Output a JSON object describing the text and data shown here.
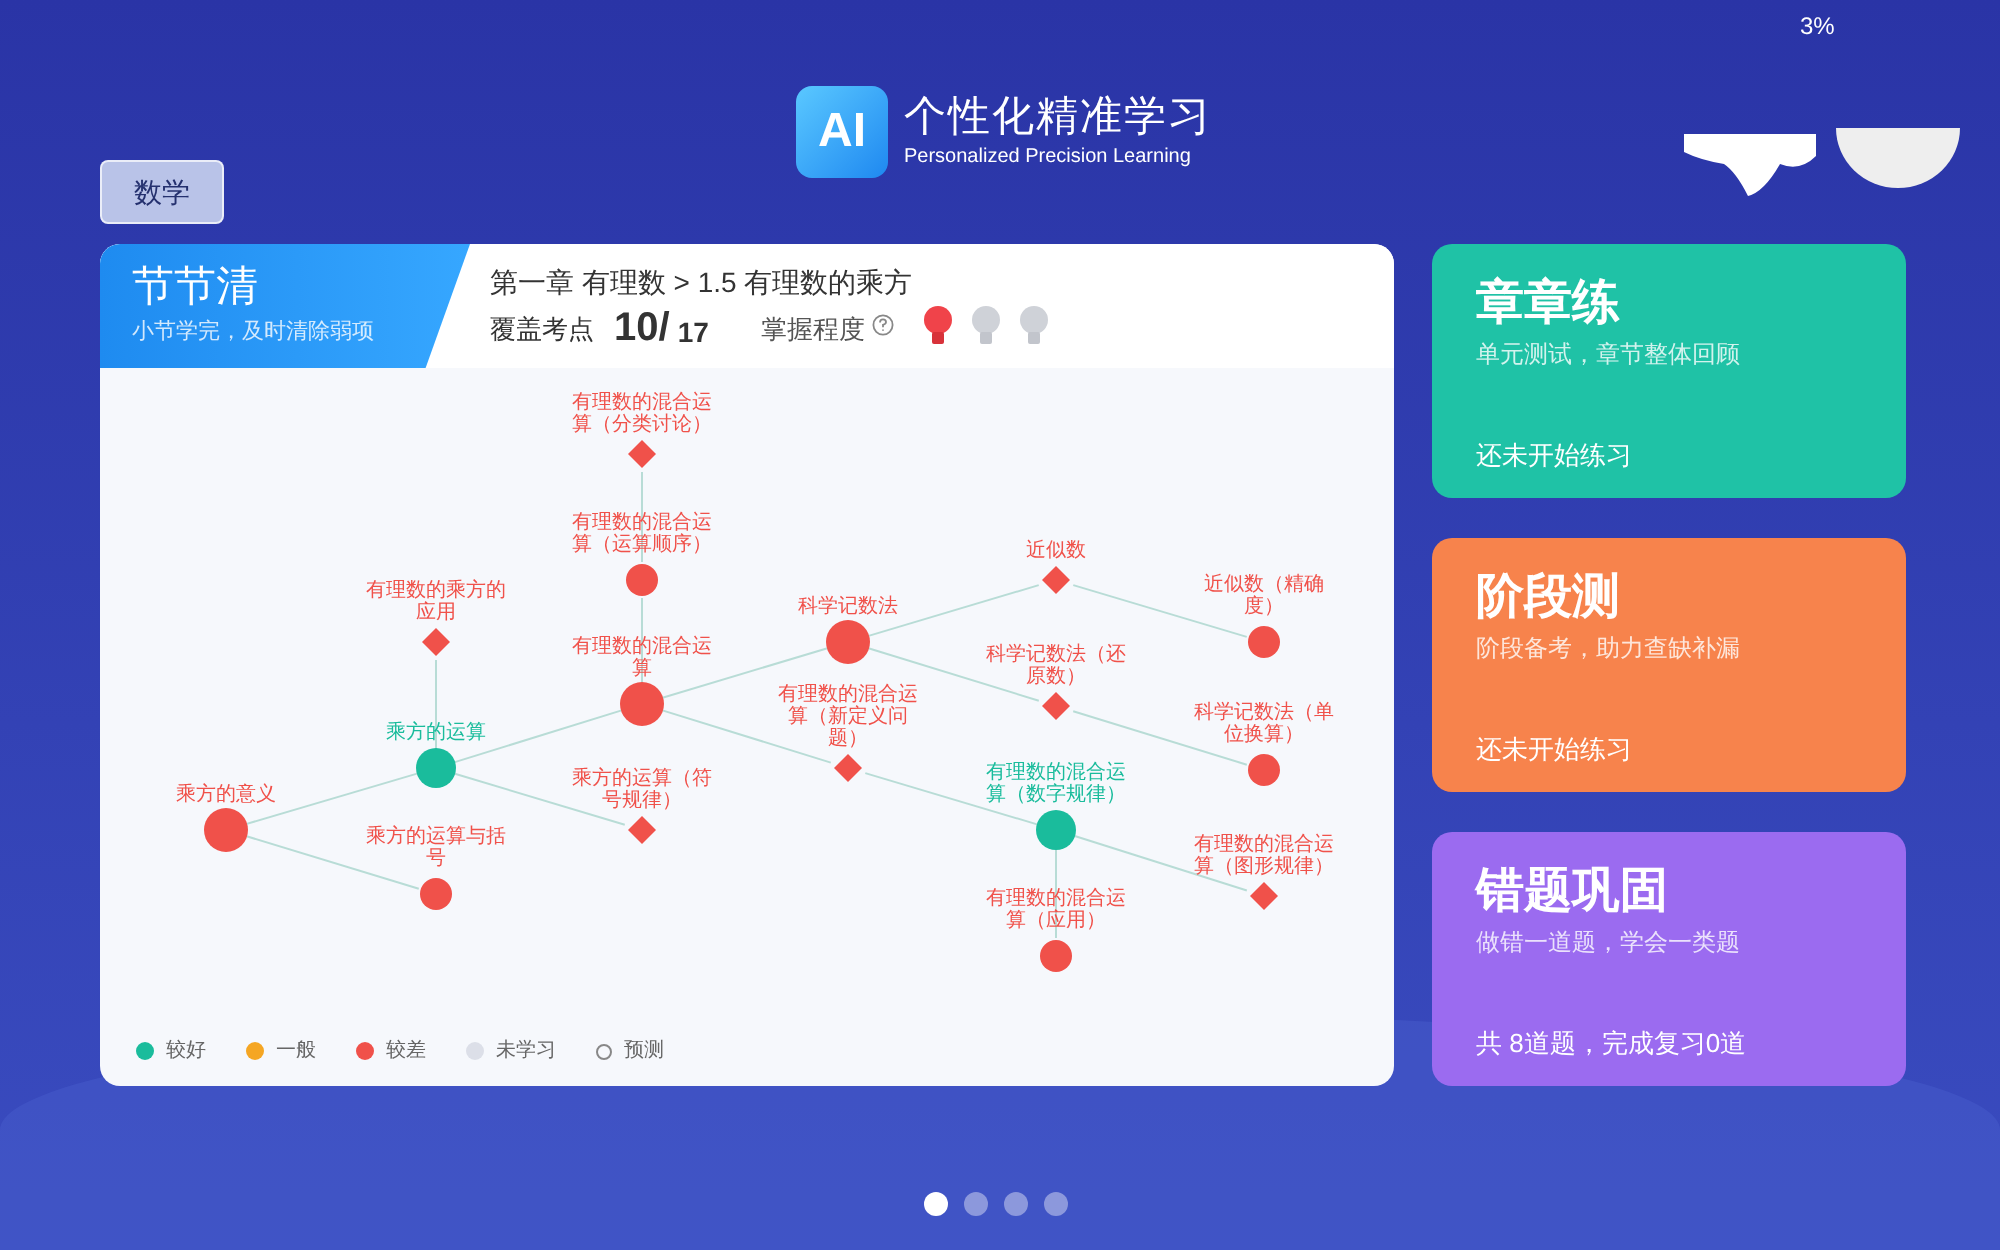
{
  "status_bar": {
    "battery": "3%"
  },
  "header": {
    "logo": "AI",
    "title": "个性化精准学习",
    "subtitle": "Personalized Precision Learning"
  },
  "subject_button": "数学",
  "main_card": {
    "tab_title": "节节清",
    "tab_subtitle": "小节学完，及时清除弱项",
    "breadcrumb": "第一章 有理数 > 1.5 有理数的乘方",
    "coverage": {
      "label": "覆盖考点",
      "count": "10/",
      "total": "17"
    },
    "mastery": {
      "label": "掌握程度",
      "bulbs": [
        {
          "lit": true
        },
        {
          "lit": false
        },
        {
          "lit": false
        }
      ]
    },
    "graph": {
      "root": {
        "label": "乘方的意义",
        "color": "#f0514a",
        "kind": "circle",
        "children": [
          {
            "label": "乘方的运算",
            "color": "#1abc9c",
            "kind": "circle",
            "children": [
              {
                "label": "有理数的乘方的应用",
                "color": "#f0514a",
                "kind": "diamond"
              },
              {
                "label": "有理数的混合运算",
                "color": "#f0514a",
                "kind": "circle",
                "children": [
                  {
                    "label": "有理数的混合运算（运算顺序）",
                    "color": "#f0514a",
                    "kind": "circle",
                    "children": [
                      {
                        "label": "有理数的混合运算（分类讨论）",
                        "color": "#f0514a",
                        "kind": "diamond"
                      }
                    ]
                  },
                  {
                    "label": "科学记数法",
                    "color": "#f0514a",
                    "kind": "circle",
                    "children": [
                      {
                        "label": "近似数",
                        "color": "#f0514a",
                        "kind": "diamond",
                        "children": [
                          {
                            "label": "近似数（精确度）",
                            "color": "#f0514a",
                            "kind": "circle"
                          }
                        ]
                      },
                      {
                        "label": "科学记数法（还原数）",
                        "color": "#f0514a",
                        "kind": "diamond",
                        "children": [
                          {
                            "label": "科学记数法（单位换算）",
                            "color": "#f0514a",
                            "kind": "circle"
                          }
                        ]
                      }
                    ]
                  },
                  {
                    "label": "有理数的混合运算（新定义问题）",
                    "color": "#f0514a",
                    "kind": "diamond",
                    "children": [
                      {
                        "label": "有理数的混合运算（数字规律）",
                        "color": "#1abc9c",
                        "kind": "circle",
                        "children": [
                          {
                            "label": "有理数的混合运算（图形规律）",
                            "color": "#f0514a",
                            "kind": "diamond"
                          },
                          {
                            "label": "有理数的混合运算（应用）",
                            "color": "#f0514a",
                            "kind": "circle"
                          }
                        ]
                      }
                    ]
                  }
                ]
              },
              {
                "label": "乘方的运算（符号规律）",
                "color": "#f0514a",
                "kind": "diamond"
              }
            ]
          },
          {
            "label": "乘方的运算与括号",
            "color": "#f0514a",
            "kind": "circle"
          }
        ]
      }
    },
    "legend": [
      {
        "label": "较好",
        "color": "#1abc9c",
        "kind": "dot"
      },
      {
        "label": "一般",
        "color": "#f5a623",
        "kind": "dot"
      },
      {
        "label": "较差",
        "color": "#f0514a",
        "kind": "dot"
      },
      {
        "label": "未学习",
        "color": "#dcdfe8",
        "kind": "dot"
      },
      {
        "label": "预测",
        "color": "#888888",
        "kind": "ring"
      }
    ]
  },
  "practice_cards": [
    {
      "title": "章章练",
      "subtitle": "单元测试，章节整体回顾",
      "status": "还未开始练习",
      "color": "#1fc2a6"
    },
    {
      "title": "阶段测",
      "subtitle": "阶段备考，助力查缺补漏",
      "status": "还未开始练习",
      "color": "#f7834c"
    },
    {
      "title": "错题巩固",
      "subtitle": "做错一道题，学会一类题",
      "status": "共 8道题，完成复习0道",
      "color": "#9b6bf0"
    }
  ],
  "pager": [
    {
      "selected": true
    },
    {
      "selected": false
    },
    {
      "selected": false
    },
    {
      "selected": false
    }
  ]
}
